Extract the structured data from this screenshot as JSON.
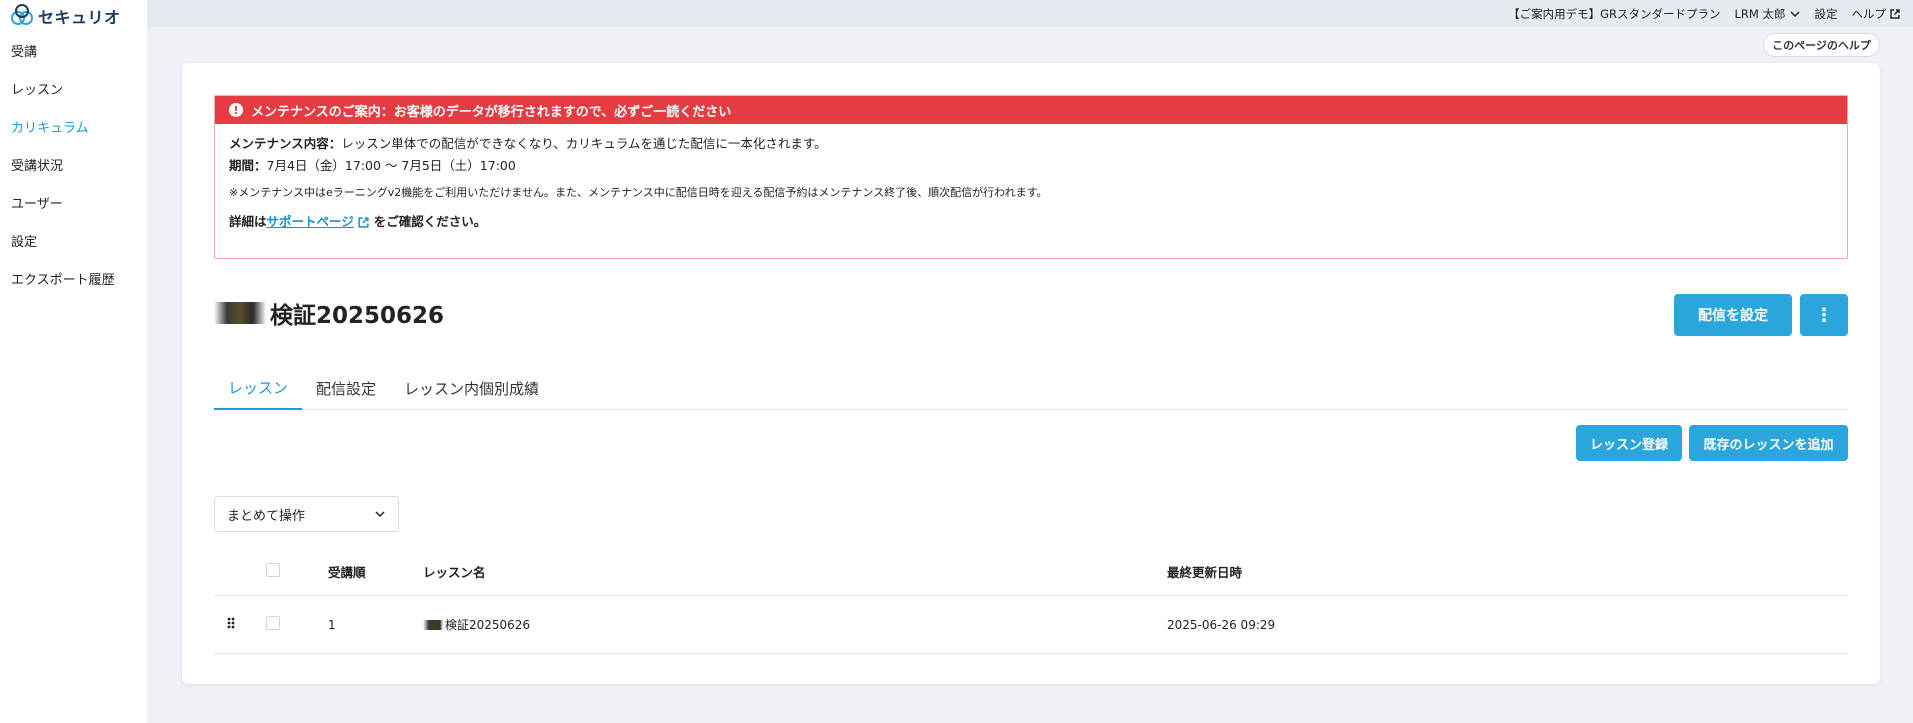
{
  "sidebar": {
    "logo_text": "セキュリオ",
    "items": [
      {
        "label": "受講"
      },
      {
        "label": "レッスン"
      },
      {
        "label": "カリキュラム"
      },
      {
        "label": "受講状況"
      },
      {
        "label": "ユーザー"
      },
      {
        "label": "設定"
      },
      {
        "label": "エクスポート履歴"
      }
    ],
    "active_index": 2,
    "active_color": "#1a9ad6"
  },
  "topbar": {
    "plan": "【ご案内用デモ】GRスタンダードプラン",
    "user": "LRM 太郎",
    "settings": "設定",
    "help": "ヘルプ"
  },
  "page_help": "このページのヘルプ",
  "alert": {
    "title": "メンテナンスのご案内：お客様のデータが移行されますので、必ずご一読ください",
    "content_label": "メンテナンス内容：",
    "content_text": "レッスン単体での配信ができなくなり、カリキュラムを通じた配信に一本化されます。",
    "period_label": "期間：",
    "period_text": "7月4日（金）17:00 〜 7月5日（土）17:00",
    "note": "※メンテナンス中はeラーニングv2機能をご利用いただけません。また、メンテナンス中に配信日時を迎える配信予約はメンテナンス終了後、順次配信が行われます。",
    "detail_prefix": "詳細は",
    "detail_link": "サポートページ",
    "detail_suffix": "をご確認ください。",
    "color": "#e53b42"
  },
  "curriculum": {
    "title": "検証20250626",
    "set_delivery_button": "配信を設定",
    "more_button": "⋮"
  },
  "tabs": [
    {
      "label": "レッスン",
      "active": true
    },
    {
      "label": "配信設定",
      "active": false
    },
    {
      "label": "レッスン内個別成績",
      "active": false
    }
  ],
  "actions": {
    "register_lesson": "レッスン登録",
    "add_existing": "既存のレッスンを追加"
  },
  "bulk_select": {
    "value": "まとめて操作"
  },
  "table": {
    "headers": {
      "order": "受講順",
      "name": "レッスン名",
      "updated": "最終更新日時"
    },
    "rows": [
      {
        "order": "1",
        "name": "検証20250626",
        "updated": "2025-06-26 09:29"
      }
    ]
  },
  "colors": {
    "primary": "#2aa6dc",
    "link": "#1a8fd0",
    "background": "#eef2f6"
  }
}
